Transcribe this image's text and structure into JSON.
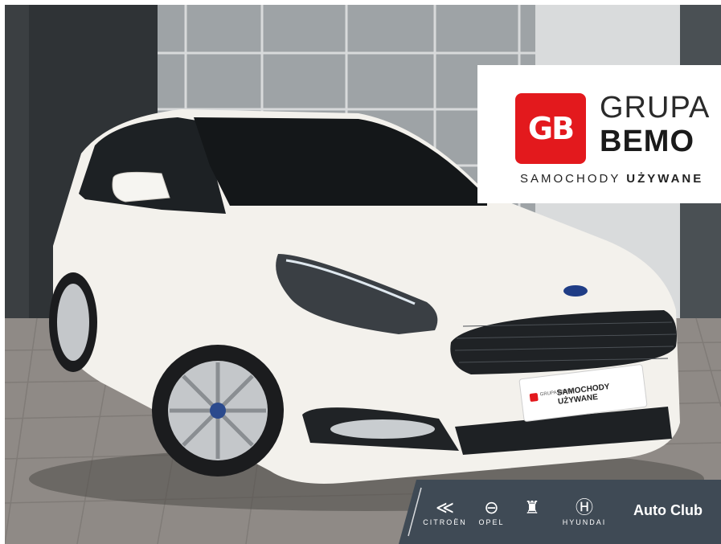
{
  "logo": {
    "badge": "GB",
    "line1": "GRUPA",
    "line2": "BEMO",
    "tagline_part1": "SAMOCHODY ",
    "tagline_part2": "UŻYWANE",
    "badge_color": "#e3191d"
  },
  "plate": {
    "mini_brand": "GRUPA BEMO",
    "text": "SAMOCHODY UŻYWANE"
  },
  "brands": [
    {
      "name": "CITROËN",
      "icon": "citroen-chevrons-icon"
    },
    {
      "name": "OPEL",
      "icon": "opel-lightning-icon"
    },
    {
      "name": "",
      "icon": "peugeot-lion-icon"
    },
    {
      "name": "HYUNDAI",
      "icon": "hyundai-h-icon"
    }
  ],
  "autoclub": "Auto Club",
  "colors": {
    "car_body": "#f3f1ec",
    "brand_bar": "#3f4a55"
  }
}
